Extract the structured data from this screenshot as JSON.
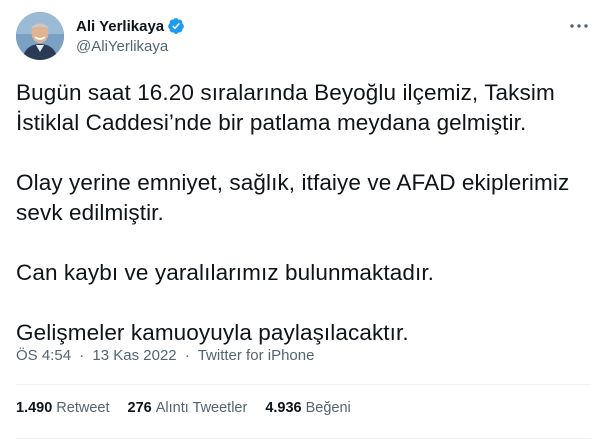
{
  "author": {
    "display_name": "Ali Yerlikaya",
    "handle": "@AliYerlikaya",
    "verified": true,
    "icons": {
      "verified": "verified-badge-icon",
      "more": "more-options-icon"
    }
  },
  "tweet": {
    "paragraphs": [
      "Bugün saat 16.20 sıralarında Beyoğlu ilçemiz, Taksim İstiklal Caddesi’nde bir patlama meydana gelmiştir.",
      "Olay yerine emniyet, sağlık, itfaiye ve AFAD ekiplerimiz sevk edilmiştir.",
      "Can kaybı ve yaralılarımız bulunmaktadır.",
      "Gelişmeler kamuoyuyla paylaşılacaktır."
    ],
    "time": "ÖS 4:54",
    "separator": "·",
    "date": "13 Kas 2022",
    "source": "Twitter for iPhone"
  },
  "stats": {
    "retweets": {
      "count": "1.490",
      "label": "Retweet"
    },
    "quotes": {
      "count": "276",
      "label": "Alıntı Tweetler"
    },
    "likes": {
      "count": "4.936",
      "label": "Beğeni"
    }
  },
  "colors": {
    "text_primary": "#0f1419",
    "text_secondary": "#536471",
    "verified_blue": "#1d9bf0",
    "divider": "#eff3f4"
  }
}
